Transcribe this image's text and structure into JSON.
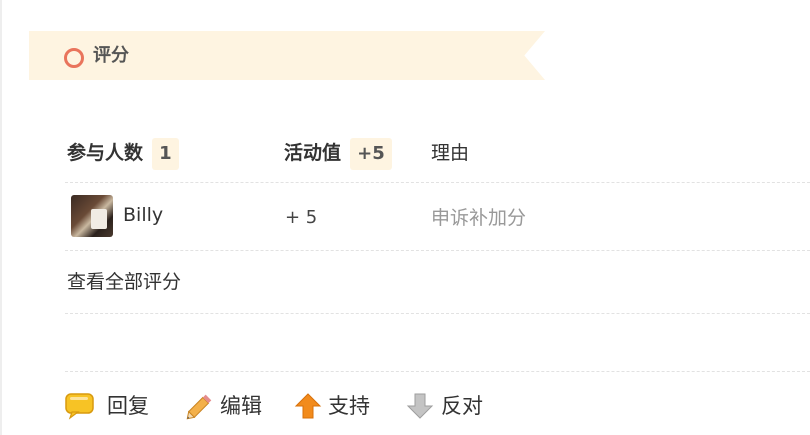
{
  "section": {
    "title": "评分"
  },
  "rating": {
    "participants_label": "参与人数",
    "participants_count": "1",
    "activity_label": "活动值",
    "activity_total": "+5",
    "reason_label": "理由",
    "entries": [
      {
        "user": "Billy",
        "score": "+ 5",
        "reason": "申诉补加分"
      }
    ],
    "view_all_label": "查看全部评分"
  },
  "actions": {
    "reply": "回复",
    "edit": "编辑",
    "support": "支持",
    "oppose": "反对"
  },
  "colors": {
    "ribbon_bg": "#fef4e1",
    "ribbon_icon": "#e9745c",
    "support_arrow": "#f28b1c",
    "oppose_arrow": "#b5b5b5",
    "reply_bubble": "#f7c325"
  }
}
